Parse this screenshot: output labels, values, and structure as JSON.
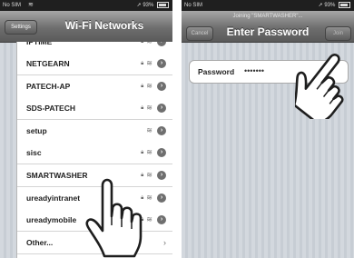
{
  "left_screen": {
    "status": {
      "carrier": "No SIM",
      "battery": "93%"
    },
    "nav": {
      "back_label": "Settings",
      "title": "Wi-Fi Networks"
    },
    "networks": [
      {
        "name": "IPTIME",
        "secured": true,
        "action": "detail"
      },
      {
        "name": "NETGEARN",
        "secured": true,
        "action": "detail"
      },
      {
        "name": "PATECH-AP",
        "secured": true,
        "action": "detail"
      },
      {
        "name": "SDS-PATECH",
        "secured": true,
        "action": "detail"
      },
      {
        "name": "setup",
        "secured": false,
        "action": "detail"
      },
      {
        "name": "sisc",
        "secured": true,
        "action": "detail"
      },
      {
        "name": "SMARTWASHER",
        "secured": true,
        "action": "detail"
      },
      {
        "name": "ureadyintranet",
        "secured": true,
        "action": "detail"
      },
      {
        "name": "ureadymobile",
        "secured": true,
        "action": "detail"
      },
      {
        "name": "Other...",
        "secured": false,
        "action": "chevron"
      }
    ]
  },
  "right_screen": {
    "status": {
      "carrier": "No SIM",
      "battery": "93%"
    },
    "nav": {
      "prompt": "Joining \"SMARTWASHER\"...",
      "title": "Enter Password",
      "cancel_label": "Cancel",
      "join_label": "Join"
    },
    "password": {
      "label": "Password",
      "masked_value": "•••••••"
    }
  },
  "icons": {
    "lock": "lock-icon",
    "wifi": "wifi-signal-icon",
    "detail": "detail-disclosure-icon",
    "chevron": "chevron-right-icon",
    "hand": "pointing-hand-icon"
  }
}
